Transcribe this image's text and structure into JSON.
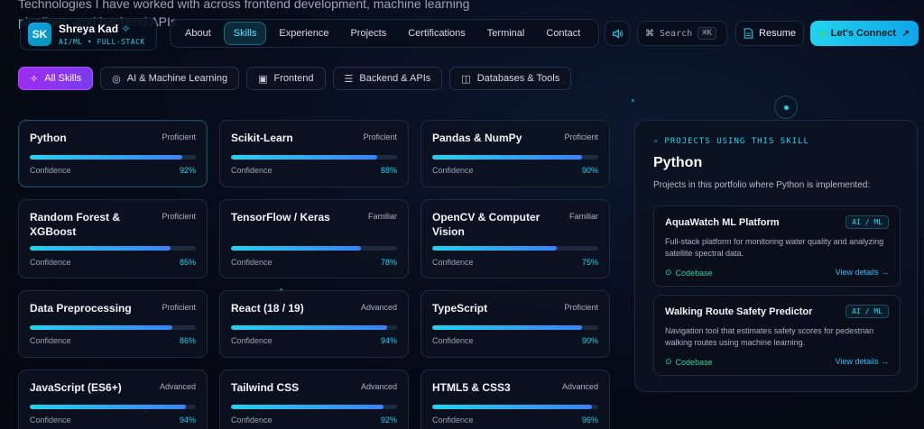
{
  "background_text": "Technologies I have worked with across frontend development, machine learning pipelines, and backend APIs.",
  "brand": {
    "initials": "SK",
    "name": "Shreya Kad",
    "tagline": "AI/ML • FULL-STACK"
  },
  "nav": {
    "items": [
      {
        "label": "About",
        "active": false
      },
      {
        "label": "Skills",
        "active": true
      },
      {
        "label": "Experience",
        "active": false
      },
      {
        "label": "Projects",
        "active": false
      },
      {
        "label": "Certifications",
        "active": false
      },
      {
        "label": "Terminal",
        "active": false
      },
      {
        "label": "Contact",
        "active": false
      }
    ]
  },
  "toolbar": {
    "sound_icon": "speaker-icon",
    "search_label": "Search",
    "search_shortcut": "⌘K",
    "resume_label": "Resume",
    "connect_label": "Let's Connect"
  },
  "filters": [
    {
      "label": "All Skills",
      "icon": "sparkle-icon",
      "active": true
    },
    {
      "label": "AI & Machine Learning",
      "icon": "brain-icon",
      "active": false
    },
    {
      "label": "Frontend",
      "icon": "layout-icon",
      "active": false
    },
    {
      "label": "Backend & APIs",
      "icon": "server-icon",
      "active": false
    },
    {
      "label": "Databases & Tools",
      "icon": "database-icon",
      "active": false
    }
  ],
  "confidence_label": "Confidence",
  "skills": [
    {
      "name": "Python",
      "level": "Proficient",
      "pct": 92,
      "pct_text": "92%"
    },
    {
      "name": "Scikit-Learn",
      "level": "Proficient",
      "pct": 88,
      "pct_text": "88%"
    },
    {
      "name": "Pandas & NumPy",
      "level": "Proficient",
      "pct": 90,
      "pct_text": "90%"
    },
    {
      "name": "Random Forest & XGBoost",
      "level": "Proficient",
      "pct": 85,
      "pct_text": "85%"
    },
    {
      "name": "TensorFlow / Keras",
      "level": "Familiar",
      "pct": 78,
      "pct_text": "78%"
    },
    {
      "name": "OpenCV & Computer Vision",
      "level": "Familiar",
      "pct": 75,
      "pct_text": "75%"
    },
    {
      "name": "Data Preprocessing",
      "level": "Proficient",
      "pct": 86,
      "pct_text": "86%"
    },
    {
      "name": "React (18 / 19)",
      "level": "Advanced",
      "pct": 94,
      "pct_text": "94%"
    },
    {
      "name": "TypeScript",
      "level": "Proficient",
      "pct": 90,
      "pct_text": "90%"
    },
    {
      "name": "JavaScript (ES6+)",
      "level": "Advanced",
      "pct": 94,
      "pct_text": "94%"
    },
    {
      "name": "Tailwind CSS",
      "level": "Advanced",
      "pct": 92,
      "pct_text": "92%"
    },
    {
      "name": "HTML5 & CSS3",
      "level": "Advanced",
      "pct": 96,
      "pct_text": "96%"
    }
  ],
  "panel": {
    "eyebrow": "PROJECTS USING THIS SKILL",
    "title": "Python",
    "subtitle": "Projects in this portfolio where Python is implemented:",
    "projects": [
      {
        "title": "AquaWatch ML Platform",
        "tag": "AI / ML",
        "description": "Full-stack platform for monitoring water quality and analyzing satellite spectral data.",
        "codebase": "Codebase",
        "details": "View details →"
      },
      {
        "title": "Walking Route Safety Predictor",
        "tag": "AI / ML",
        "description": "Navigation tool that estimates safety scores for pedestrian walking routes using machine learning.",
        "codebase": "Codebase",
        "details": "View details →"
      }
    ]
  }
}
